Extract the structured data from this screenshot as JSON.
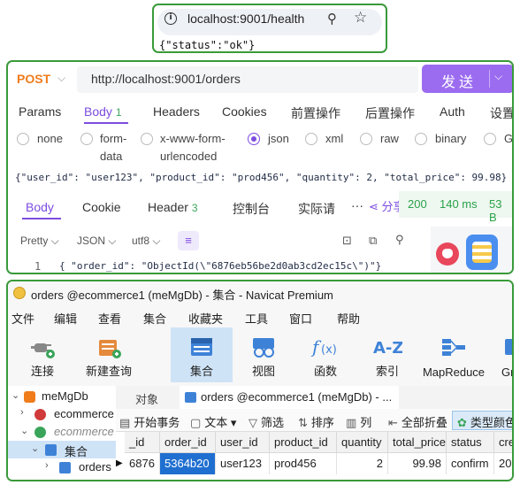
{
  "browser": {
    "url": "localhost:9001/health",
    "response": "{\"status\":\"ok\"}"
  },
  "api": {
    "method": "POST",
    "url": "http://localhost:9001/orders",
    "send_label": "发送",
    "request_tabs": [
      {
        "label": "Params"
      },
      {
        "label": "Body",
        "count": "1"
      },
      {
        "label": "Headers"
      },
      {
        "label": "Cookies"
      },
      {
        "label": "前置操作"
      },
      {
        "label": "后置操作"
      },
      {
        "label": "Auth"
      },
      {
        "label": "设置"
      }
    ],
    "body_types": [
      "none",
      "form-data",
      "x-www-form-urlencoded",
      "json",
      "xml",
      "raw",
      "binary",
      "Gr"
    ],
    "body_type_selected": "json",
    "request_body": "{\"user_id\": \"user123\", \"product_id\": \"prod456\", \"quantity\": 2, \"total_price\": 99.98}",
    "response_tabs": [
      {
        "label": "Body"
      },
      {
        "label": "Cookie"
      },
      {
        "label": "Header",
        "count": "3"
      },
      {
        "label": "控制台"
      },
      {
        "label": "实际请"
      }
    ],
    "more": "···",
    "share": "分享",
    "status_code": "200",
    "time": "140 ms",
    "size": "53 B",
    "view_mode": "Pretty",
    "format": "JSON",
    "encoding": "utf8",
    "line_number": "1",
    "response_line": "{ \"order_id\": \"ObjectId(\\\"6876eb56be2d0ab3cd2ec15c\\\")\"}"
  },
  "navicat": {
    "title": "orders @ecommerce1 (meMgDb) - 集合 - Navicat Premium",
    "menu": [
      "文件",
      "编辑",
      "查看",
      "集合",
      "收藏夹",
      "工具",
      "窗口",
      "帮助"
    ],
    "toolbar": [
      {
        "label": "连接",
        "icon": "plug-icon"
      },
      {
        "label": "新建查询",
        "icon": "new-query-icon"
      },
      {
        "label": "集合",
        "icon": "collection-icon"
      },
      {
        "label": "视图",
        "icon": "view-icon"
      },
      {
        "label": "函数",
        "icon": "function-icon"
      },
      {
        "label": "索引",
        "icon": "index-icon"
      },
      {
        "label": "MapReduce",
        "icon": "mapreduce-icon"
      },
      {
        "label": "Grid",
        "icon": "grid-icon"
      }
    ],
    "tree": [
      {
        "label": "meMgDb"
      },
      {
        "label": "ecommerce"
      },
      {
        "label": "ecommerce"
      },
      {
        "label": "集合"
      },
      {
        "label": "orders"
      }
    ],
    "tabs": {
      "objects": "对象",
      "document": "orders @ecommerce1 (meMgDb) - ..."
    },
    "subtoolbar": [
      "开始事务",
      "文本 ▾",
      "筛选",
      "排序",
      "列",
      "全部折叠",
      "类型颜色"
    ],
    "columns": [
      "_id",
      "order_id",
      "user_id",
      "product_id",
      "quantity",
      "total_price",
      "status",
      "creat"
    ],
    "row": [
      "6876",
      "5364b20",
      "user123",
      "prod456",
      "2",
      "99.98",
      "confirm",
      "2025"
    ]
  }
}
